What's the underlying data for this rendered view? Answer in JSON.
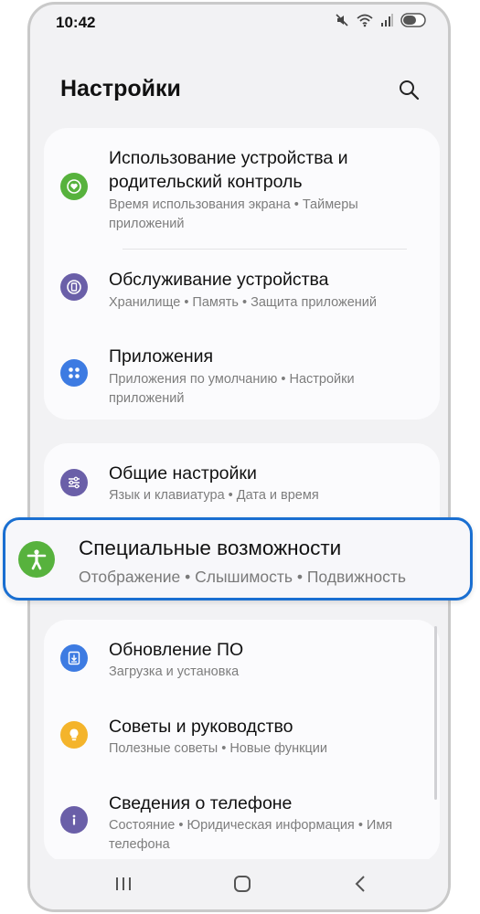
{
  "status_bar": {
    "time": "10:42",
    "icons": [
      "mute-icon",
      "wifi-icon",
      "signal-icon",
      "toggle-icon"
    ]
  },
  "header": {
    "title": "Настройки",
    "search_icon": "search-icon"
  },
  "groups": [
    {
      "items": [
        {
          "title": "Использование устройства и родительский контроль",
          "subtitle": "Время использования экрана • Таймеры приложений",
          "icon": "heart-icon",
          "icon_color": "#57b23d"
        },
        {
          "title": "Обслуживание устройства",
          "subtitle": "Хранилище • Память • Защита приложений",
          "icon": "device-care-icon",
          "icon_color": "#6a5fa8"
        },
        {
          "title": "Приложения",
          "subtitle": "Приложения по умолчанию • Настройки приложений",
          "icon": "apps-icon",
          "icon_color": "#3d7be2"
        }
      ]
    },
    {
      "items": [
        {
          "title": "Общие настройки",
          "subtitle": "Язык и клавиатура • Дата и время",
          "icon": "sliders-icon",
          "icon_color": "#6a5fa8"
        }
      ]
    },
    {
      "items": [
        {
          "title": "Обновление ПО",
          "subtitle": "Загрузка и установка",
          "icon": "download-icon",
          "icon_color": "#3d7be2"
        },
        {
          "title": "Советы и руководство",
          "subtitle": "Полезные советы • Новые функции",
          "icon": "lightbulb-icon",
          "icon_color": "#f4b42b"
        },
        {
          "title": "Сведения о телефоне",
          "subtitle": "Состояние • Юридическая информация • Имя телефона",
          "icon": "info-icon",
          "icon_color": "#6a5fa8"
        }
      ]
    }
  ],
  "highlighted": {
    "title": "Специальные возможности",
    "subtitle": "Отображение • Слышимость • Подвижность",
    "icon": "accessibility-icon",
    "icon_color": "#57b23d",
    "border_color": "#1a6fd1"
  },
  "nav_bar": {
    "icons": [
      "recent-apps-icon",
      "home-icon",
      "back-icon"
    ]
  }
}
